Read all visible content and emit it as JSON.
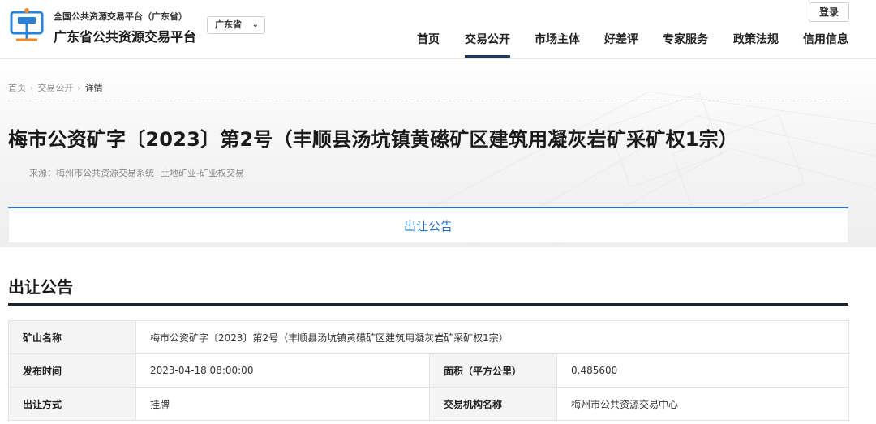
{
  "header": {
    "platform_small": "全国公共资源交易平台（广东省）",
    "platform_name": "广东省公共资源交易平台",
    "region_select": "广东省",
    "login_label": "登录",
    "nav": [
      "首页",
      "交易公开",
      "市场主体",
      "好差评",
      "专家服务",
      "政策法规",
      "信用信息"
    ],
    "nav_active": "交易公开"
  },
  "breadcrumb": [
    "首页",
    "交易公开",
    "详情"
  ],
  "title": "梅市公资矿字〔2023〕第2号（丰顺县汤坑镇黄礤矿区建筑用凝灰岩矿采矿权1宗）",
  "source": {
    "text": "来源：梅州市公共资源交易系统",
    "category": "土地矿业-矿业权交易"
  },
  "tab_label": "出让公告",
  "section_title": "出让公告",
  "info": {
    "mine_name_label": "矿山名称",
    "mine_name_value": "梅市公资矿字〔2023〕第2号（丰顺县汤坑镇黄礤矿区建筑用凝灰岩矿采矿权1宗）",
    "publish_time_label": "发布时间",
    "publish_time_value": "2023-04-18 08:00:00",
    "area_label": "面积（平方公里）",
    "area_value": "0.485600",
    "method_label": "出让方式",
    "method_value": "挂牌",
    "agency_label": "交易机构名称",
    "agency_value": "梅州市公共资源交易中心"
  },
  "colors": {
    "accent": "#2a6fc9",
    "nav_underline": "#1e3a5f",
    "logo_blue": "#2a82d6",
    "logo_orange": "#f08a24"
  }
}
